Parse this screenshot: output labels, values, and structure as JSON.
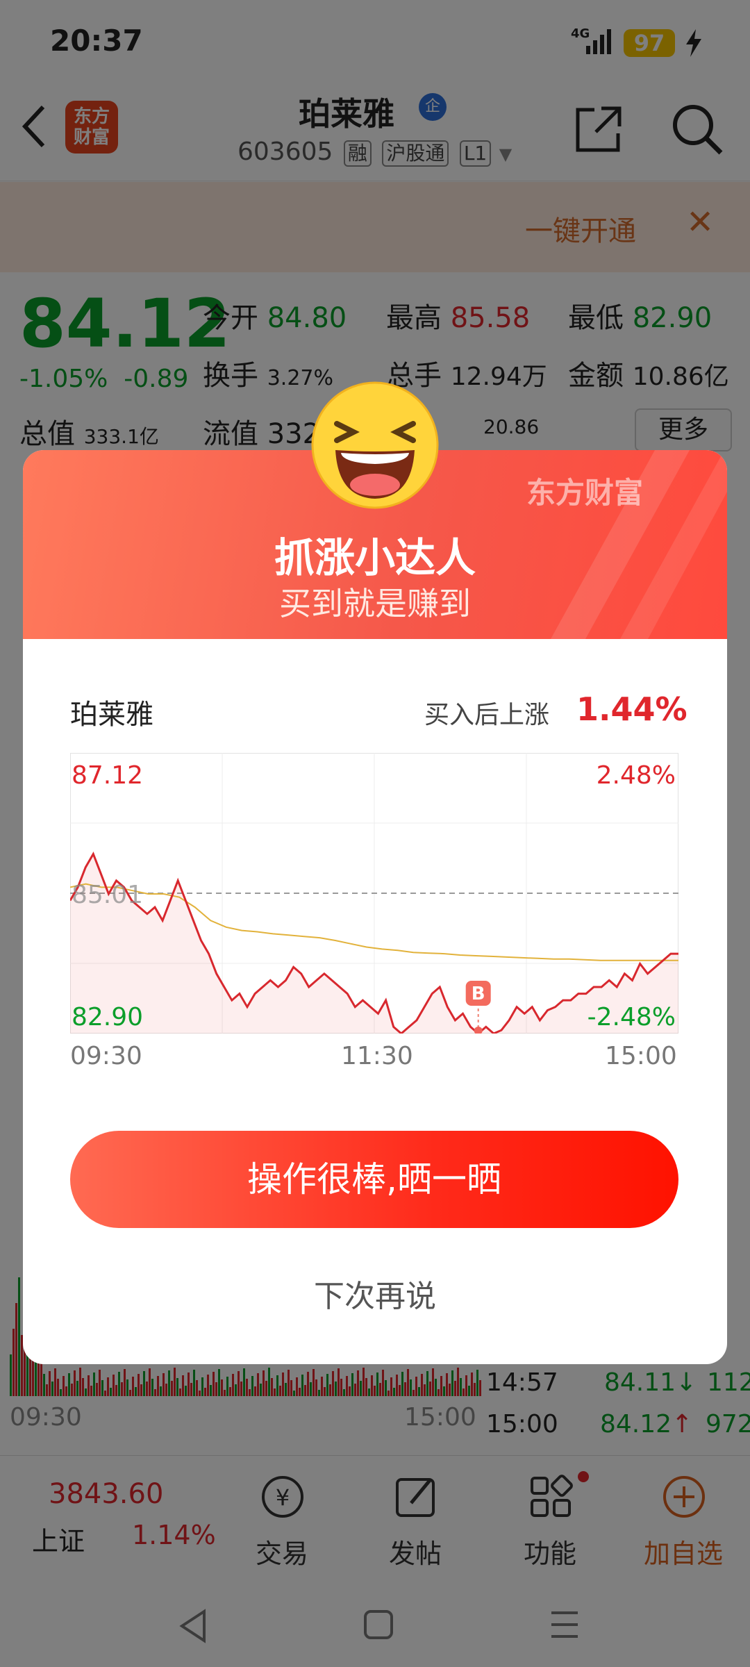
{
  "status_bar": {
    "time": "20:37",
    "network": "4G",
    "battery": "97"
  },
  "header": {
    "app_logo": "东方\n财富",
    "stock_name": "珀莱雅",
    "badge": "企",
    "code": "603605",
    "tags": [
      "融",
      "沪股通",
      "L1"
    ]
  },
  "promo": {
    "text": "一键开通",
    "close": "✕"
  },
  "quote": {
    "price": "84.12",
    "change_pct": "-1.05%",
    "change_abs": "-0.89",
    "open_label": "今开",
    "open": "84.80",
    "high_label": "最高",
    "high": "85.58",
    "low_label": "最低",
    "low": "82.90",
    "turnover_label": "换手",
    "turnover": "3.27%",
    "volume_label": "总手",
    "volume": "12.94万",
    "amount_label": "金额",
    "amount": "10.86亿",
    "mktcap_label": "总值",
    "mktcap": "333.1亿",
    "float_label": "流值",
    "float_partial": "332",
    "pe_value": "20.86",
    "more": "更多"
  },
  "trades": [
    {
      "time": "14:57",
      "price": "84.11",
      "arrow": "↓",
      "vol": "112"
    },
    {
      "time": "15:00",
      "price": "84.12",
      "arrow": "↑",
      "vol": "972"
    }
  ],
  "bg_chart": {
    "start": "09:30",
    "end": "15:00"
  },
  "tabbar": {
    "index_value": "3843.60",
    "index_name": "上证",
    "index_change": "1.14%",
    "items": [
      {
        "label": "交易",
        "icon": "yen-exchange-icon"
      },
      {
        "label": "发帖",
        "icon": "edit-post-icon"
      },
      {
        "label": "功能",
        "icon": "grid-icon"
      },
      {
        "label": "加自选",
        "icon": "plus-circle-icon"
      }
    ]
  },
  "modal": {
    "brand": "东方财富",
    "title": "抓涨小达人",
    "subtitle": "买到就是赚到",
    "stock": "珀莱雅",
    "rise_label": "买入后上涨",
    "rise_value": "1.44%",
    "share_button": "操作很棒,晒一晒",
    "later_button": "下次再说",
    "buy_marker": "B"
  },
  "chart_data": {
    "type": "line",
    "y_max_label": "87.12",
    "y_min_label": "82.90",
    "y_ref_label": "85.01",
    "pct_max_label": "2.48%",
    "pct_min_label": "-2.48%",
    "x_labels": [
      "09:30",
      "11:30",
      "15:00"
    ],
    "ylim": [
      82.9,
      87.12
    ],
    "reference_price": 85.01,
    "series": [
      {
        "values": [
          84.9,
          85.1,
          85.4,
          85.6,
          85.3,
          85.0,
          85.2,
          85.1,
          84.9,
          84.8,
          84.7,
          84.8,
          84.6,
          84.9,
          85.2,
          84.9,
          84.6,
          84.3,
          84.1,
          83.8,
          83.6,
          83.4,
          83.5,
          83.3,
          83.5,
          83.6,
          83.7,
          83.6,
          83.7,
          83.9,
          83.8,
          83.6,
          83.7,
          83.8,
          83.7,
          83.6,
          83.5,
          83.3,
          83.4,
          83.3,
          83.2,
          83.4,
          83.0,
          82.9,
          83.0,
          83.1,
          83.3,
          83.5,
          83.6,
          83.3,
          83.1,
          83.2,
          83.0,
          82.9,
          83.0,
          82.9,
          82.95,
          83.1,
          83.3,
          83.2,
          83.3,
          83.1,
          83.25,
          83.3,
          83.4,
          83.4,
          83.5,
          83.5,
          83.6,
          83.6,
          83.7,
          83.6,
          83.8,
          83.7,
          83.95,
          83.8,
          83.9,
          84.0,
          84.1,
          84.1
        ]
      },
      {
        "values": [
          85.1,
          85.15,
          85.1,
          85.1,
          85.05,
          85.0,
          85.0,
          84.95,
          84.8,
          84.6,
          84.5,
          84.45,
          84.43,
          84.4,
          84.38,
          84.36,
          84.34,
          84.3,
          84.25,
          84.2,
          84.17,
          84.15,
          84.12,
          84.11,
          84.1,
          84.08,
          84.07,
          84.06,
          84.05,
          84.04,
          84.03,
          84.02,
          84.02,
          84.01,
          84.0,
          84.0,
          84.0,
          84.0,
          84.0,
          84.0
        ]
      }
    ],
    "buy_point": {
      "index": 53,
      "price": 82.9
    }
  },
  "colors": {
    "up": "#e0262c",
    "down": "#0b9e2a",
    "modal_head": "#f5584a",
    "avg_line": "#e2b23b"
  }
}
